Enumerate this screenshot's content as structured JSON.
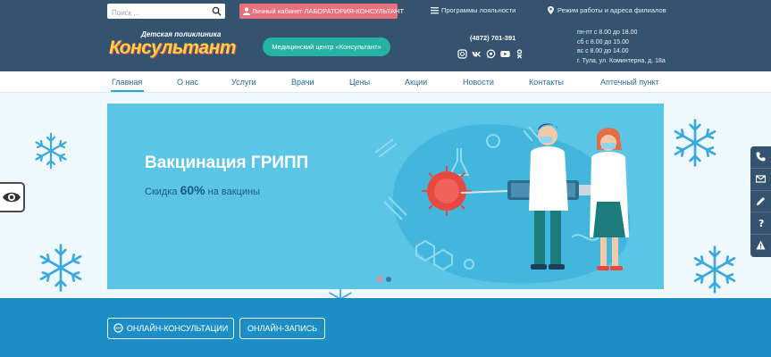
{
  "topbar": {
    "search_placeholder": "Поиск ...",
    "cabinet_label": "Личный кабинет ЛАБОРАТОРИЯ-КОНСУЛЬТАНТ",
    "loyalty_label": "Программы лояльности",
    "branches_label": "Режим работы и адреса филиалов"
  },
  "header": {
    "logo_sub": "Детская поликлиника",
    "logo_main": "Консультант",
    "med_center_button": "Медицинский центр «Консультант»",
    "phone": "(4872) 701-391",
    "socials": [
      "odnoklassniki-icon",
      "vk-icon",
      "whatsapp-icon",
      "youtube-icon",
      "ok-icon"
    ],
    "hours": [
      "пн-пт с 8.00 до 18.00",
      "сб с 8.00 до 15.00",
      "вс с 8.00 до 14.00",
      "г. Тула, ул. Коминтерна, д. 18а"
    ]
  },
  "nav": {
    "items": [
      "Главная",
      "О нас",
      "Услуги",
      "Врачи",
      "Цены",
      "Акции",
      "Новости",
      "Контакты",
      "Аптечный пункт"
    ],
    "active": "Главная"
  },
  "banner": {
    "title": "Вакцинация ГРИПП",
    "subtitle_prefix": "Скидка",
    "subtitle_value": "60%",
    "subtitle_suffix": "на вакцины",
    "slide_count": 2,
    "active_slide": 2
  },
  "sidepanel": {
    "icons": [
      "phone-icon",
      "mail-icon",
      "pen-icon",
      "question-icon",
      "warning-icon"
    ]
  },
  "bottom": {
    "online_consult": "ОНЛАЙН-КОНСУЛЬТАЦИИ",
    "online_booking": "ОНЛАЙН-ЗАПИСЬ"
  },
  "colors": {
    "header_bg": "#33536f",
    "cabinet_bg": "#e8717d",
    "med_button": "#26b3a3",
    "banner_bg": "#5ac5e6",
    "strip_bg": "#1c8ec6",
    "nav_text": "#1f6f97"
  }
}
